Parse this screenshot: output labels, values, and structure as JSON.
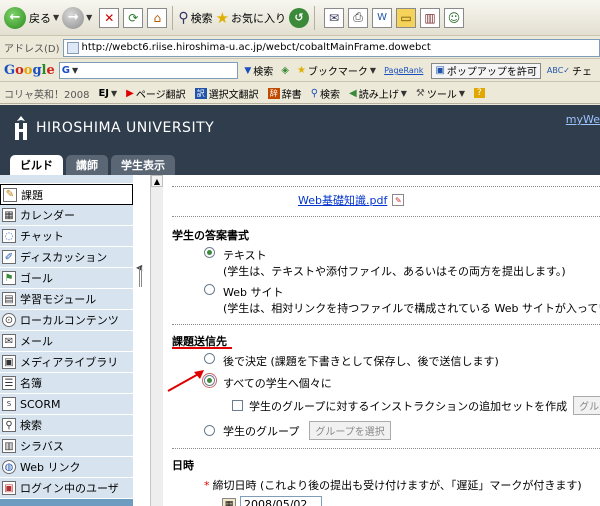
{
  "toolbar": {
    "back_label": "戻る",
    "search_label": "検索",
    "favorites_label": "お気に入り"
  },
  "address": {
    "label": "アドレス(D)",
    "url": "http://webct6.riise.hiroshima-u.ac.jp/webct/cobaltMainFrame.dowebct"
  },
  "google": {
    "logo": "Google",
    "input_value": "G",
    "search_label": "検索",
    "bookmark_label": "ブックマーク",
    "pagerank_label": "PageRank",
    "popup_label": "ポップアップを許可",
    "spell_label": "チェ"
  },
  "langbar": {
    "dict_label": "コリャ英和！2008",
    "ej_label": "EJ",
    "page_translate": "ページ翻訳",
    "select_translate": "選択文翻訳",
    "dictionary": "辞書",
    "search": "検索",
    "read_aloud": "読み上げ",
    "tools": "ツール"
  },
  "banner": {
    "university": "HIROSHIMA UNIVERSITY",
    "my_link": "myWe"
  },
  "tabs": [
    {
      "label": "ビルド",
      "active": true
    },
    {
      "label": "講師",
      "active": false
    },
    {
      "label": "学生表示",
      "active": false
    }
  ],
  "sidebar": {
    "items": [
      {
        "label": "課題",
        "icon": "assignment-icon",
        "active": true
      },
      {
        "label": "カレンダー",
        "icon": "calendar-icon"
      },
      {
        "label": "チャット",
        "icon": "chat-icon"
      },
      {
        "label": "ディスカッション",
        "icon": "discussion-icon"
      },
      {
        "label": "ゴール",
        "icon": "goal-icon"
      },
      {
        "label": "学習モジュール",
        "icon": "learning-module-icon"
      },
      {
        "label": "ローカルコンテンツ",
        "icon": "local-content-icon"
      },
      {
        "label": "メール",
        "icon": "mail-icon"
      },
      {
        "label": "メディアライブラリ",
        "icon": "media-library-icon"
      },
      {
        "label": "名簿",
        "icon": "roster-icon"
      },
      {
        "label": "SCORM",
        "icon": "scorm-icon"
      },
      {
        "label": "検索",
        "icon": "search-icon"
      },
      {
        "label": "シラバス",
        "icon": "syllabus-icon"
      },
      {
        "label": "Web リンク",
        "icon": "web-link-icon"
      },
      {
        "label": "ログイン中のユーザ",
        "icon": "users-online-icon"
      }
    ]
  },
  "main": {
    "file_link": "Web基礎知識.pdf",
    "answer_format": {
      "title": "学生の答案書式",
      "options": [
        {
          "label": "テキスト",
          "desc": "(学生は、テキストや添付ファイル、あるいはその両方を提出します。)",
          "selected": true
        },
        {
          "label": "Web サイト",
          "desc": "(学生は、相対リンクを持つファイルで構成されている Web サイトが入ってい",
          "selected": false
        }
      ]
    },
    "submission": {
      "title": "課題送信先",
      "later": "後で決定 (課題を下書きとして保存し、後で送信します)",
      "all_students": "すべての学生へ個々に",
      "checkbox_label": "学生のグループに対するインストラクションの追加セットを作成",
      "group_button": "グルーブ",
      "student_group": "学生のグループ",
      "choose_group_button": "グループを選択"
    },
    "dates": {
      "title": "日時",
      "deadline": "締切日時 (これより後の提出も受け付けますが、「遅延」マークが付きます)",
      "date_value": "2008/05/02"
    }
  }
}
